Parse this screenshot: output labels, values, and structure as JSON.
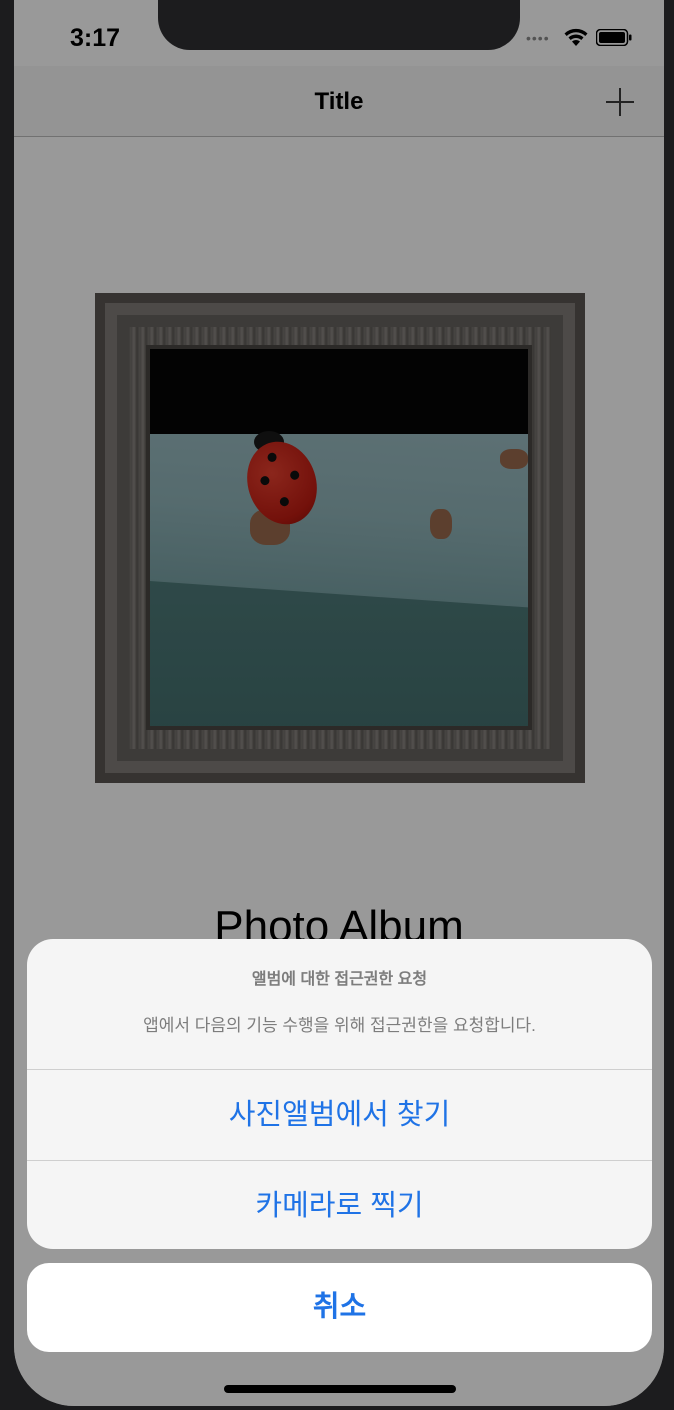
{
  "status_bar": {
    "time": "3:17",
    "signal_icon": "signal-dots-icon",
    "wifi_icon": "wifi-icon",
    "battery_icon": "battery-icon"
  },
  "nav": {
    "title": "Title",
    "add_icon": "plus-icon"
  },
  "content": {
    "image_description_icon": "framed-photo",
    "album_title": "Photo Album"
  },
  "action_sheet": {
    "title": "앨범에 대한 접근권한 요청",
    "message": "앱에서 다음의 기능 수행을 위해 접근권한을 요청합니다.",
    "buttons": [
      {
        "label": "사진앨범에서 찾기"
      },
      {
        "label": "카메라로 찍기"
      }
    ],
    "cancel_label": "취소",
    "accent_color": "#1f73e6"
  }
}
